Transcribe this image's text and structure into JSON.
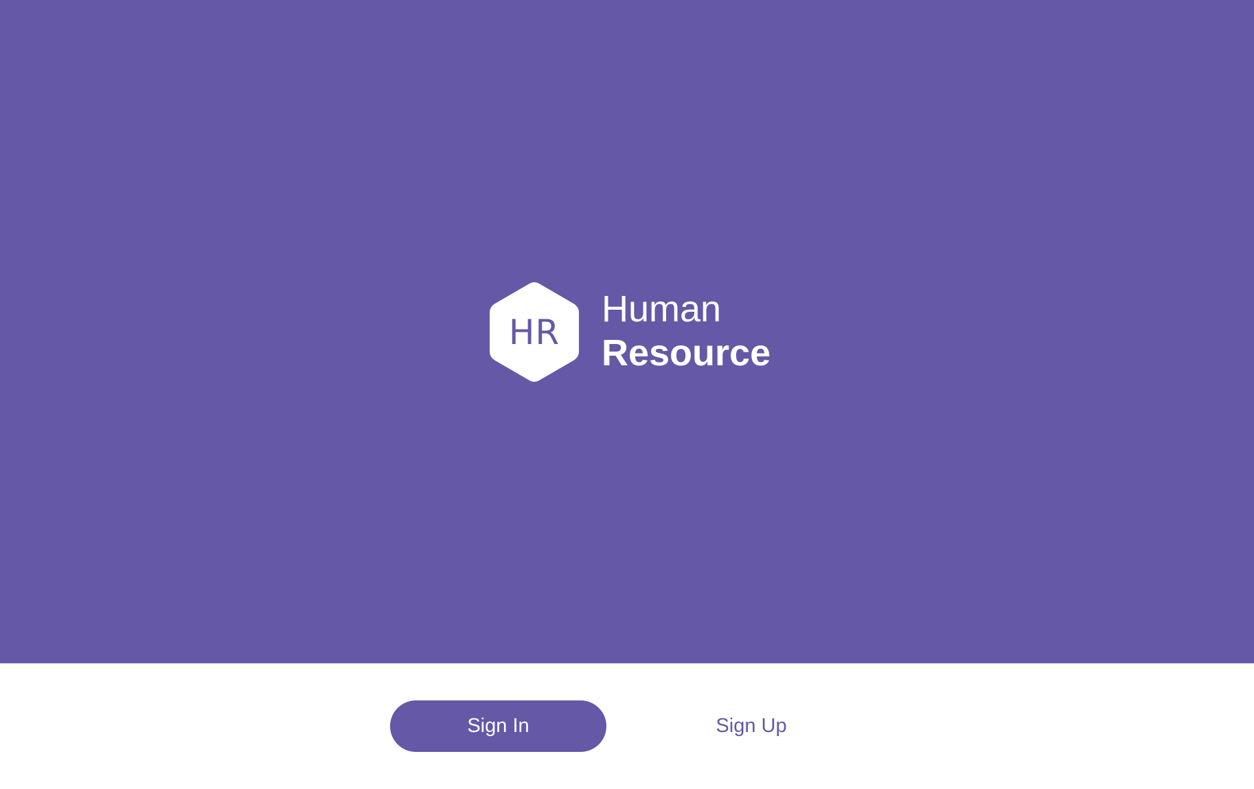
{
  "brand": {
    "logo_text": "HR",
    "title_line1": "Human",
    "title_line2": "Resource"
  },
  "actions": {
    "sign_in_label": "Sign In",
    "sign_up_label": "Sign Up"
  },
  "colors": {
    "primary": "#6558a6",
    "background": "#ffffff"
  }
}
